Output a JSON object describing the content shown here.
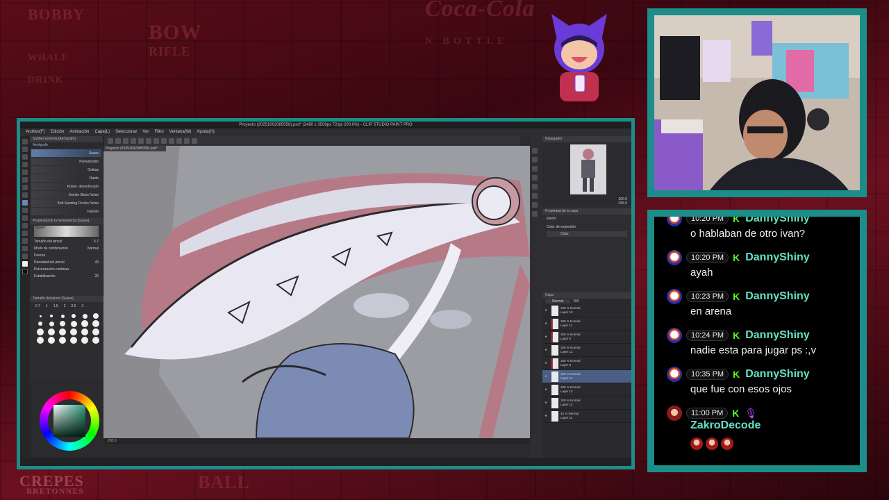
{
  "app": {
    "title": "Proyecto (20251002085058).psd* (2480 x 3508px 72dpi 200.0%) - CLIP STUDIO PAINT PRO",
    "menu": [
      "Archivo(F)",
      "Edición",
      "Animación",
      "Capa(L)",
      "Seleccionar",
      "Ver",
      "Filtro",
      "Ventana(W)",
      "Ayuda(H)"
    ],
    "canvas_tab": "Proyecto (20251002085058).psd*",
    "brush_panel": {
      "header": "Subherramienta [Aerógrafo]",
      "tab": "Aerógrafo",
      "brushes": [
        "Suave",
        "Pulverizador",
        "Gotitas",
        "Ruido",
        "Pulver. desenfocado",
        "Smoke Bless Noise",
        "Soft Sanding Circles Noise",
        "Flashto"
      ],
      "properties_title": "Propiedad de la herramienta [Suave]",
      "preview_label": "Suave",
      "props": [
        {
          "label": "Tamaño del pincel",
          "value": "5.7"
        },
        {
          "label": "Modo de combinación",
          "value": "Normal"
        },
        {
          "label": "Dureza",
          "value": ""
        },
        {
          "label": "Densidad del pincel",
          "value": "43"
        },
        {
          "label": "Pulverización continua",
          "value": ""
        },
        {
          "label": "Estabilización",
          "value": "26"
        }
      ]
    },
    "size_panel": {
      "header": "Tamaño del pincel [Suave]",
      "sizes": [
        "0.7",
        "1",
        "1.5",
        "2",
        "2.5",
        "3"
      ]
    },
    "status": "200.0",
    "navigator": {
      "title": "Navegador",
      "zoom": "200.0",
      "angle": "-156.5"
    },
    "layer_props": {
      "title": "Propiedad de la capa",
      "effect": "Efecto",
      "expr_label": "Color de expresión",
      "expr_value": "Color"
    },
    "layers_panel": {
      "title": "Capa",
      "blend": "Normal",
      "opacity": "100"
    },
    "layers": [
      {
        "mode": "100 % Normal",
        "name": "Layer 10",
        "red": false,
        "sel": false
      },
      {
        "mode": "100 % Normal",
        "name": "Layer 11",
        "red": true,
        "sel": false
      },
      {
        "mode": "100 % Normal",
        "name": "Layer 9",
        "red": true,
        "sel": false
      },
      {
        "mode": "100 % Normal",
        "name": "Layer 12",
        "red": false,
        "sel": false
      },
      {
        "mode": "100 % Normal",
        "name": "Layer 8",
        "red": true,
        "sel": false
      },
      {
        "mode": "100 % Normal",
        "name": "Layer 13",
        "red": false,
        "sel": true
      },
      {
        "mode": "100 % Normal",
        "name": "Layer 13",
        "red": false,
        "sel": false
      },
      {
        "mode": "100 % Normal",
        "name": "Layer 12",
        "red": false,
        "sel": false
      },
      {
        "mode": "42 % Normal",
        "name": "Layer 11",
        "red": false,
        "sel": false
      }
    ]
  },
  "chat": {
    "messages": [
      {
        "time": "10:20 PM",
        "user": "DannyShiny",
        "text": "o hablaban de otro ivan?",
        "avatar": "danny",
        "mic": false
      },
      {
        "time": "10:20 PM",
        "user": "DannyShiny",
        "text": "ayah",
        "avatar": "danny",
        "mic": false
      },
      {
        "time": "10:23 PM",
        "user": "DannyShiny",
        "text": "en arena",
        "avatar": "danny",
        "mic": false
      },
      {
        "time": "10:24 PM",
        "user": "DannyShiny",
        "text": "nadie esta para jugar ps :,v",
        "avatar": "danny",
        "mic": false
      },
      {
        "time": "10:35 PM",
        "user": "DannyShiny",
        "text": "que fue con esos ojos",
        "avatar": "danny",
        "mic": false
      },
      {
        "time": "11:00 PM",
        "user": "ZakroDecode",
        "text": "",
        "avatar": "zakro",
        "mic": true
      }
    ],
    "kick_badge": "K",
    "mic_badge": "🎙"
  },
  "background": {
    "posters": [
      "Coca-Cola",
      "N BOTTLE",
      "BOW",
      "RIFLE",
      "WHALE",
      "DRINK",
      "CREPES",
      "BRETONNES",
      "BOBBY",
      "BALL"
    ]
  },
  "colors": {
    "frame": "#1b8e8a",
    "bg": "#5a0d18",
    "kick": "#53fc18",
    "username": "#63e0c2"
  }
}
